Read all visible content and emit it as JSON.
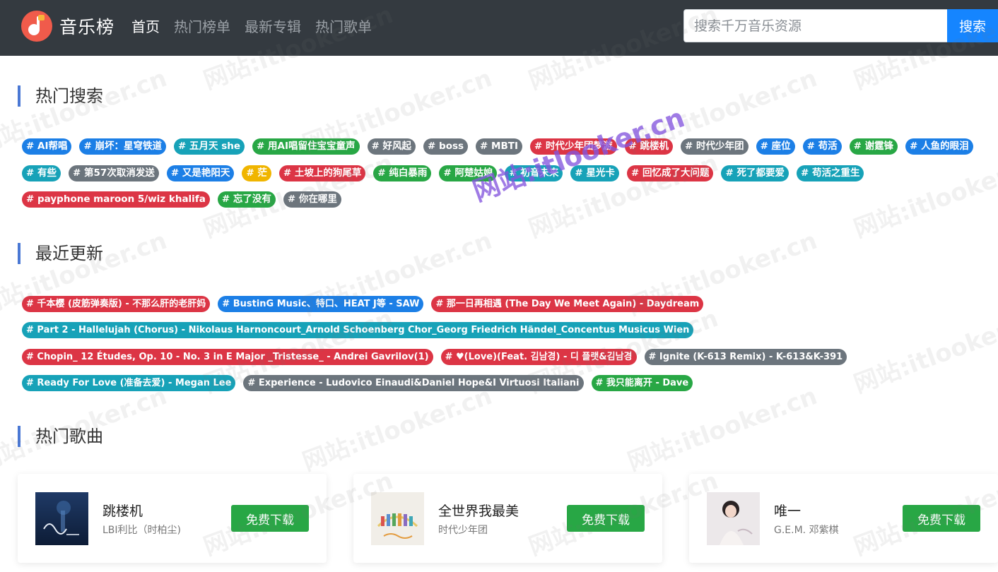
{
  "header": {
    "brand": "音乐榜",
    "nav": [
      {
        "label": "首页",
        "active": true
      },
      {
        "label": "热门榜单",
        "active": false
      },
      {
        "label": "最新专辑",
        "active": false
      },
      {
        "label": "热门歌单",
        "active": false
      }
    ],
    "search_placeholder": "搜索千万音乐资源",
    "search_button": "搜索"
  },
  "hot_search": {
    "title": "热门搜索",
    "rows": [
      [
        {
          "label": "# AI帮唱",
          "color": "#1c7fe6"
        },
        {
          "label": "# 崩坏：星穹铁道",
          "color": "#1c7fe6"
        },
        {
          "label": "# 五月天 she",
          "color": "#17a2b8"
        },
        {
          "label": "# 用AI唱留住宝宝童声",
          "color": "#28a745"
        },
        {
          "label": "# 好风起",
          "color": "#6c757d"
        },
        {
          "label": "# boss",
          "color": "#6c757d"
        },
        {
          "label": "# MBTI",
          "color": "#6c757d"
        },
        {
          "label": "# 时代少年团梦游",
          "color": "#dc3545"
        },
        {
          "label": "# 跳楼机",
          "color": "#dc3545"
        },
        {
          "label": "# 时代少年团",
          "color": "#6c757d"
        },
        {
          "label": "# 座位",
          "color": "#1c7fe6"
        },
        {
          "label": "# 苟活",
          "color": "#1c7fe6"
        },
        {
          "label": "# 谢霆锋",
          "color": "#28a745"
        },
        {
          "label": "# 人鱼的眼泪",
          "color": "#1c7fe6"
        }
      ],
      [
        {
          "label": "# 有些",
          "color": "#17a2b8"
        },
        {
          "label": "# 第57次取消发送",
          "color": "#6c757d"
        },
        {
          "label": "# 又是艳阳天",
          "color": "#1c7fe6"
        },
        {
          "label": "# 茫",
          "color": "#f0b500"
        },
        {
          "label": "# 土坡上的狗尾草",
          "color": "#dc3545"
        },
        {
          "label": "# 纯白暴雨",
          "color": "#28a745"
        },
        {
          "label": "# 阿楚姑娘",
          "color": "#28a745"
        },
        {
          "label": "# 初音未来",
          "color": "#17a2b8"
        },
        {
          "label": "# 星光卡",
          "color": "#17a2b8"
        },
        {
          "label": "# 回忆成了大问题",
          "color": "#dc3545"
        },
        {
          "label": "# 死了都要爱",
          "color": "#17a2b8"
        },
        {
          "label": "# 苟活之重生",
          "color": "#17a2b8"
        }
      ],
      [
        {
          "label": "# payphone maroon 5/wiz khalifa",
          "color": "#dc3545"
        },
        {
          "label": "# 忘了没有",
          "color": "#28a745"
        },
        {
          "label": "# 你在哪里",
          "color": "#6c757d"
        }
      ]
    ]
  },
  "recent_updates": {
    "title": "最近更新",
    "rows": [
      [
        {
          "label": "# 千本樱 (皮筋弹奏版) - 不那么肝的老肝妈",
          "color": "#dc3545"
        },
        {
          "label": "# BustinG Music、特口、HEAT J等 - SAW",
          "color": "#1c7fe6"
        },
        {
          "label": "# 那一日再相遇 (The Day We Meet Again) - Daydream",
          "color": "#dc3545"
        }
      ],
      [
        {
          "label": "# Part 2 - Hallelujah (Chorus) - Nikolaus Harnoncourt_Arnold Schoenberg Chor_Georg Friedrich Händel_Concentus Musicus Wien",
          "color": "#17a2b8"
        }
      ],
      [
        {
          "label": "# Chopin_ 12 Études, Op. 10 - No. 3 in E Major _Tristesse_ - Andrei Gavrilov(1)",
          "color": "#dc3545"
        },
        {
          "label": "# ♥(Love)(Feat. 김남경) - 디 플랫&김남경",
          "color": "#dc3545"
        },
        {
          "label": "# Ignite (K-613 Remix) - K-613&K-391",
          "color": "#6c757d"
        }
      ],
      [
        {
          "label": "# Ready For Love (准备去爱) - Megan Lee",
          "color": "#17a2b8"
        },
        {
          "label": "# Experience - Ludovico Einaudi&Daniel Hope&I Virtuosi Italiani",
          "color": "#6c757d"
        },
        {
          "label": "# 我只能离开 - Dave",
          "color": "#28a745"
        }
      ]
    ]
  },
  "hot_songs": {
    "title": "热门歌曲",
    "songs": [
      {
        "name": "跳楼机",
        "artist": "LBI利比（时柏尘)",
        "download": "免费下载"
      },
      {
        "name": "全世界我最美",
        "artist": "时代少年团",
        "download": "免费下载"
      },
      {
        "name": "唯一",
        "artist": "G.E.M. 邓紫棋",
        "download": "免费下载"
      }
    ]
  },
  "watermark": {
    "text": "网站:itlooker.cn"
  }
}
